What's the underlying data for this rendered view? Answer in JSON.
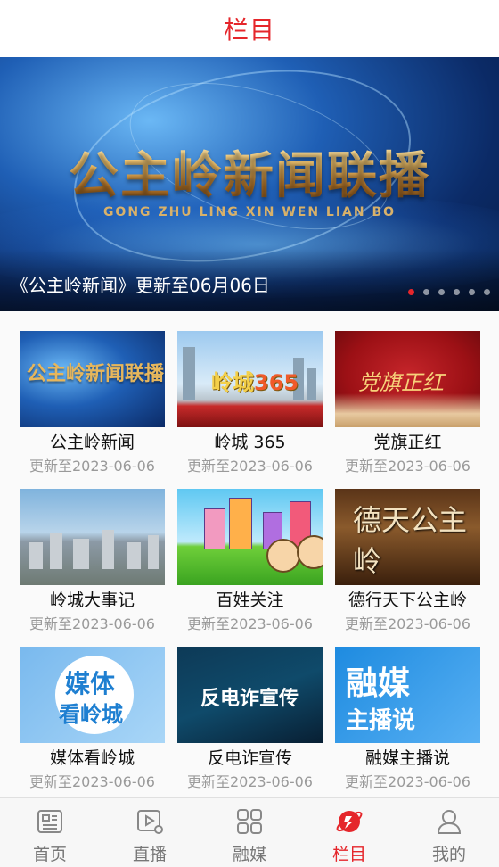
{
  "header": {
    "title": "栏目"
  },
  "banner": {
    "title": "公主岭新闻联播",
    "pinyin": "GONG ZHU LING XIN WEN LIAN BO",
    "caption": "《公主岭新闻》更新至06月06日",
    "slide_count": 6,
    "active_slide": 1
  },
  "programs": [
    {
      "name": "公主岭新闻",
      "update": "更新至2023-06-06",
      "thumb_text": "公主岭新闻联播"
    },
    {
      "name": "岭城 365",
      "update": "更新至2023-06-06",
      "thumb_text_a": "岭城",
      "thumb_text_b": "365"
    },
    {
      "name": "党旗正红",
      "update": "更新至2023-06-06",
      "thumb_text": "党旗正红"
    },
    {
      "name": "岭城大事记",
      "update": "更新至2023-06-06"
    },
    {
      "name": "百姓关注",
      "update": "更新至2023-06-06"
    },
    {
      "name": "德行天下公主岭",
      "update": "更新至2023-06-06",
      "thumb_text": "德天公主岭"
    },
    {
      "name": "媒体看岭城",
      "update": "更新至2023-06-06",
      "thumb_text_a": "媒体",
      "thumb_text_b": "看岭城"
    },
    {
      "name": "反电诈宣传",
      "update": "更新至2023-06-06",
      "thumb_text": "反电诈宣传"
    },
    {
      "name": "融媒主播说",
      "update": "更新至2023-06-06",
      "thumb_text_a": "融媒",
      "thumb_text_b": "主播说"
    }
  ],
  "tabbar": {
    "items": [
      {
        "label": "首页",
        "icon": "home-doc-icon"
      },
      {
        "label": "直播",
        "icon": "live-video-icon"
      },
      {
        "label": "融媒",
        "icon": "grid-icon"
      },
      {
        "label": "栏目",
        "icon": "column-planet-icon"
      },
      {
        "label": "我的",
        "icon": "user-icon"
      }
    ],
    "active_index": 3
  },
  "colors": {
    "accent": "#e5262b",
    "muted_text": "#9a9a9a"
  }
}
